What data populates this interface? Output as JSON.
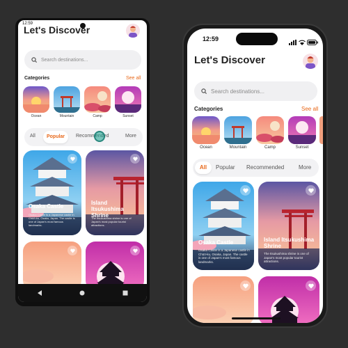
{
  "android": {
    "status_time": "12:59",
    "nav": {
      "back": "back-icon",
      "home": "home-icon",
      "recents": "recents-icon"
    }
  },
  "iphone": {
    "status_time": "12:59"
  },
  "app": {
    "title": "Let's Discover",
    "search_placeholder": "Search destinations...",
    "categories_label": "Categories",
    "see_all": "See all",
    "categories": [
      {
        "label": "Ocean"
      },
      {
        "label": "Mountain"
      },
      {
        "label": "Camp"
      },
      {
        "label": "Sunset"
      }
    ],
    "tabs": [
      "All",
      "Popular",
      "Recommended",
      "More"
    ],
    "cards": [
      {
        "title": "Osaka Castle",
        "desc": "Osaka Castle is a Japanese castle in Chūō-ku, Osaka, Japan. The castle is one of Japan's most famous landmarks."
      },
      {
        "title": "Island Itsukushima Shrine",
        "desc": "The Itsukushima shrine is one of Japan's most popular tourist attractions."
      }
    ]
  },
  "colors": {
    "accent": "#e8681a"
  }
}
